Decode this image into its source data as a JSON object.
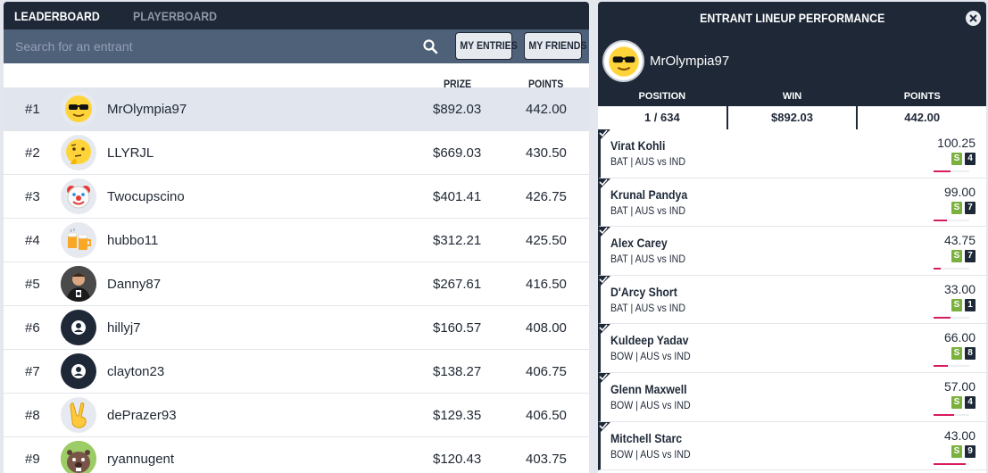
{
  "leaderboard": {
    "tabs": [
      {
        "label": "LEADERBOARD"
      },
      {
        "label": "PLAYERBOARD"
      }
    ],
    "search": {
      "placeholder": "Search for an entrant"
    },
    "buttons": {
      "my_entries": "MY ENTRIES",
      "my_friends": "MY FRIENDS"
    },
    "columns": {
      "prize": "PRIZE",
      "points": "POINTS"
    },
    "rows": [
      {
        "rank": "#1",
        "name": "MrOlympia97",
        "prize": "$892.03",
        "points": "442.00",
        "avatar": "sunglasses-face"
      },
      {
        "rank": "#2",
        "name": "LLYRJL",
        "prize": "$669.03",
        "points": "430.50",
        "avatar": "thinking-face"
      },
      {
        "rank": "#3",
        "name": "Twocupscino",
        "prize": "$401.41",
        "points": "426.75",
        "avatar": "clown-face"
      },
      {
        "rank": "#4",
        "name": "hubbo11",
        "prize": "$312.21",
        "points": "425.50",
        "avatar": "beer-mugs"
      },
      {
        "rank": "#5",
        "name": "Danny87",
        "prize": "$267.61",
        "points": "416.50",
        "avatar": "photo"
      },
      {
        "rank": "#6",
        "name": "hillyj7",
        "prize": "$160.57",
        "points": "408.00",
        "avatar": "default-user"
      },
      {
        "rank": "#7",
        "name": "clayton23",
        "prize": "$138.27",
        "points": "406.75",
        "avatar": "default-user"
      },
      {
        "rank": "#8",
        "name": "dePrazer93",
        "prize": "$129.35",
        "points": "406.50",
        "avatar": "victory-hand"
      },
      {
        "rank": "#9",
        "name": "ryannugent",
        "prize": "$120.43",
        "points": "403.75",
        "avatar": "beaver"
      }
    ]
  },
  "lineup": {
    "title": "ENTRANT LINEUP PERFORMANCE",
    "entrant": "MrOlympia97",
    "stats": [
      {
        "label": "POSITION",
        "value": "1 / 634"
      },
      {
        "label": "WIN",
        "value": "$892.03"
      },
      {
        "label": "POINTS",
        "value": "442.00"
      }
    ],
    "players": [
      {
        "name": "Virat Kohli",
        "role": "BAT",
        "team": "AUS",
        "opp": "IND",
        "points": "100.25",
        "s_label": "S",
        "count": "4",
        "progress": 0.47
      },
      {
        "name": "Krunal Pandya",
        "role": "BAT",
        "team": "AUS",
        "opp": "IND",
        "points": "99.00",
        "s_label": "S",
        "count": "7",
        "progress": 0.38
      },
      {
        "name": "Alex Carey",
        "role": "BAT",
        "team": "AUS",
        "opp": "IND",
        "points": "43.75",
        "s_label": "S",
        "count": "7",
        "progress": 0.2
      },
      {
        "name": "D'Arcy Short",
        "role": "BAT",
        "team": "AUS",
        "opp": "IND",
        "points": "33.00",
        "s_label": "S",
        "count": "1",
        "progress": 0.47
      },
      {
        "name": "Kuldeep Yadav",
        "role": "BOW",
        "team": "AUS",
        "opp": "IND",
        "points": "66.00",
        "s_label": "S",
        "count": "8",
        "progress": 0.4
      },
      {
        "name": "Glenn Maxwell",
        "role": "BOW",
        "team": "AUS",
        "opp": "IND",
        "points": "57.00",
        "s_label": "S",
        "count": "4",
        "progress": 0.58
      },
      {
        "name": "Mitchell Starc",
        "role": "BOW",
        "team": "AUS",
        "opp": "IND",
        "points": "43.00",
        "s_label": "S",
        "count": "9",
        "progress": 0.9
      }
    ]
  },
  "colors": {
    "navy": "#1e2837",
    "search": "#4f6079",
    "highlight": "#e0e5ee",
    "green": "#7ab13e",
    "pink": "#d81b60"
  }
}
